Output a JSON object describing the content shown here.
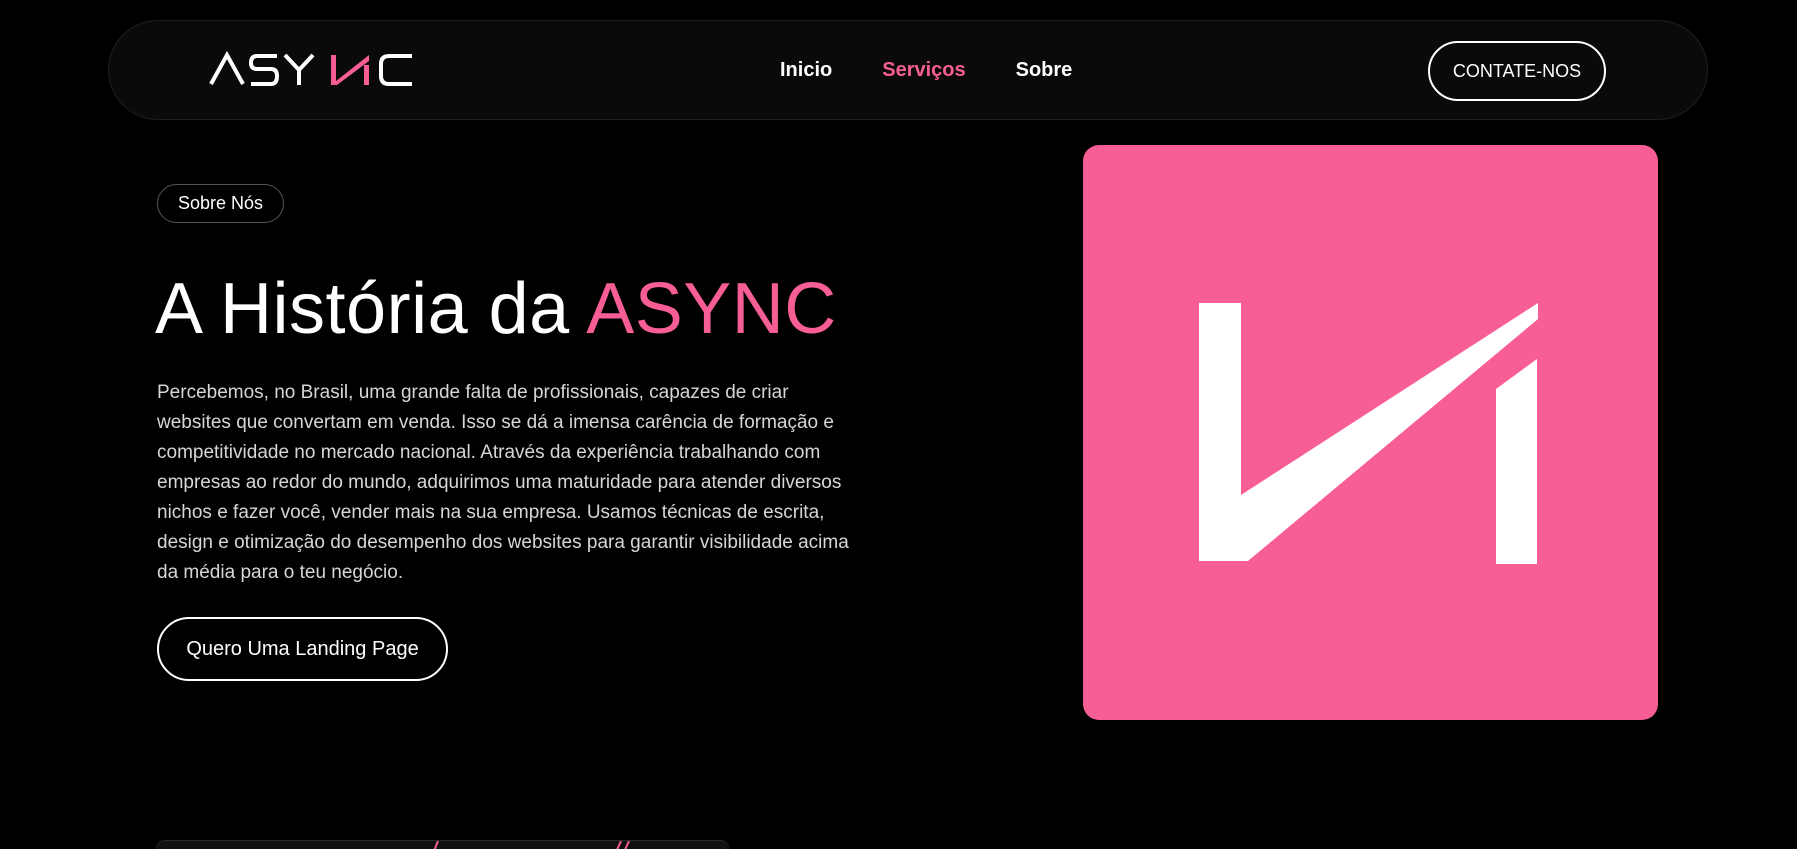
{
  "header": {
    "logo_text": "ASYNC",
    "nav": [
      {
        "label": "Inicio",
        "active": false
      },
      {
        "label": "Serviços",
        "active": true
      },
      {
        "label": "Sobre",
        "active": false
      }
    ],
    "contact_label": "CONTATE-NOS"
  },
  "about": {
    "badge": "Sobre Nós",
    "title_prefix": "A História da ",
    "title_highlight": "ASYNC",
    "body": "Percebemos, no Brasil, uma grande falta de profissionais, capazes de criar websites que convertam em venda. Isso se dá a imensa carência de formação e competitividade no mercado nacional. Através da experiência trabalhando com empresas ao redor do mundo, adquirimos uma maturidade para atender diversos nichos e fazer você, vender mais na sua empresa. Usamos técnicas de escrita, design e otimização do desempenho dos websites para garantir visibilidade acima da média para o teu negócio.",
    "cta_label": "Quero Uma Landing Page"
  },
  "colors": {
    "accent": "#f75e95",
    "background": "#000000",
    "text": "#ffffff"
  },
  "icons": [
    "async-logo",
    "async-n-mark-icon"
  ]
}
